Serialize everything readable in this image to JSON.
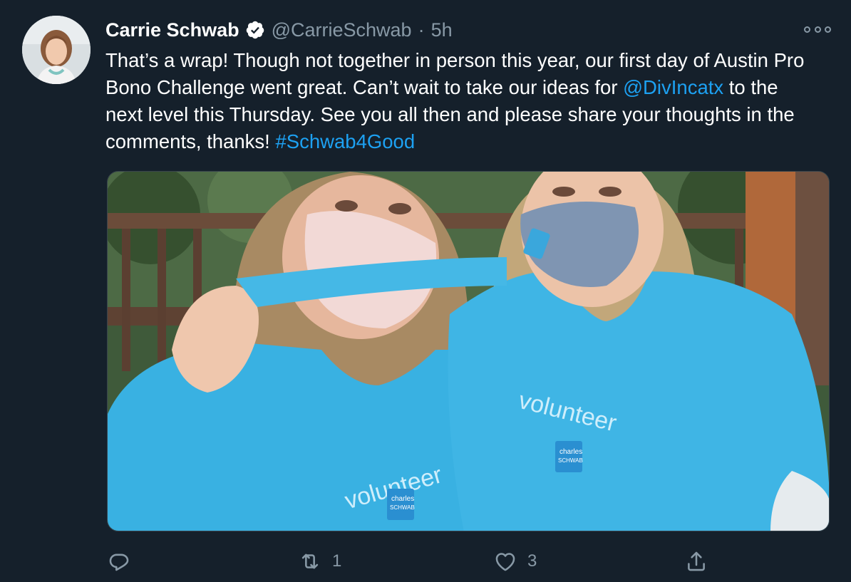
{
  "tweet": {
    "author_name": "Carrie Schwab",
    "handle": "@CarrieSchwab",
    "separator": "·",
    "time": "5h",
    "text_parts": {
      "p1": "That’s a wrap! Though not together in person this year, our first day of Austin Pro Bono Challenge went great. Can’t wait to take our ideas for ",
      "mention": "@DivIncatx",
      "p2": " to the next level this Thursday. See you all then and please share your thoughts in the comments, thanks! ",
      "hashtag": "#Schwab4Good"
    },
    "media": {
      "shirt_text_left": "volunteer",
      "shirt_text_right": "volunteer",
      "logo_text_line1": "charles",
      "logo_text_line2": "SCHWAB",
      "mask_logo_text": "charles"
    }
  },
  "actions": {
    "reply_count": "",
    "retweet_count": "1",
    "like_count": "3"
  },
  "icons": {
    "verified": "verified-badge-icon",
    "more": "more-icon",
    "reply": "reply-icon",
    "retweet": "retweet-icon",
    "like": "heart-icon",
    "share": "share-icon"
  },
  "colors": {
    "background": "#15202b",
    "text": "#ffffff",
    "secondary": "#8899a6",
    "link": "#1da1f2"
  }
}
